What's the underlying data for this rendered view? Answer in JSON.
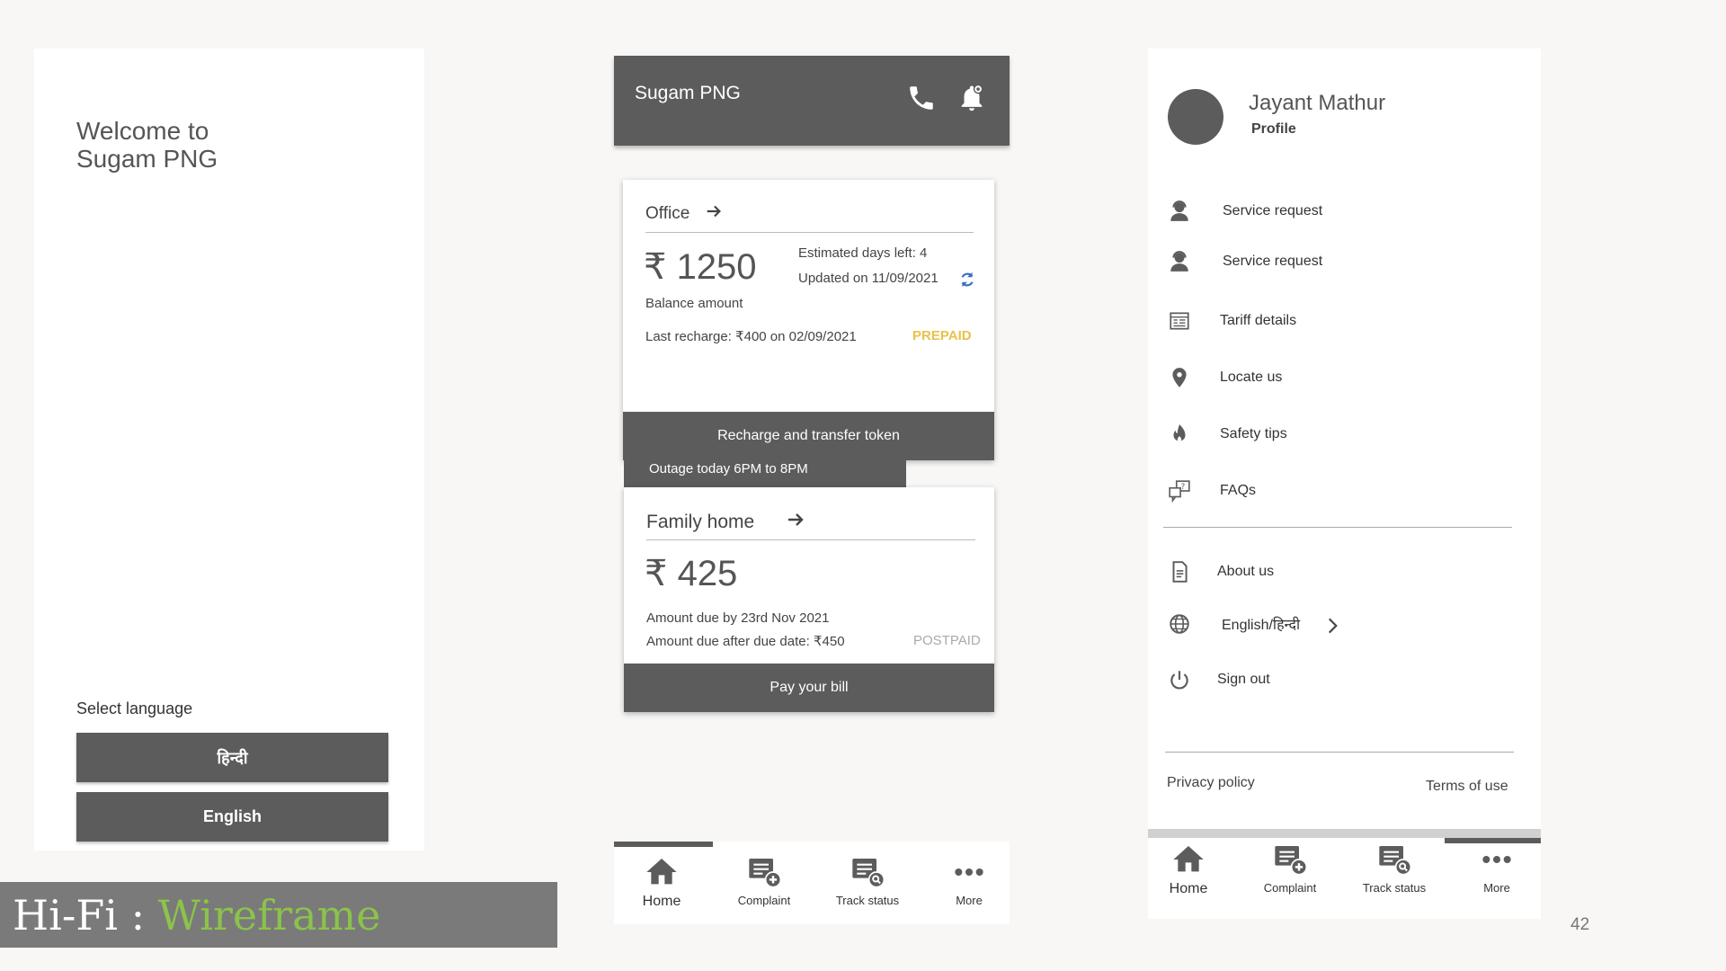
{
  "welcome_screen": {
    "welcome_line1": "Welcome to",
    "welcome_line2": "Sugam PNG",
    "select_language_label": "Select language",
    "hindi_button": "हिन्दी",
    "english_button": "English"
  },
  "banner": {
    "prefix": "Hi-Fi : ",
    "accent": "Wireframe",
    "accent_color": "#8bc34a"
  },
  "home_screen": {
    "app_title": "Sugam PNG",
    "call_icon": "phone-icon",
    "notification_icon": "bell-icon",
    "office_card": {
      "title": "Office",
      "amount": "₹ 1250",
      "amount_caption": "Balance amount",
      "estimated_days": "Estimated days left: 4",
      "updated_on": "Updated on 11/09/2021",
      "last_recharge": "Last recharge: ₹400 on 02/09/2021",
      "tag": "PREPAID",
      "tag_color": "#e8c24a",
      "button": "Recharge and transfer token"
    },
    "outage_notice": "Outage today 6PM to 8PM",
    "family_card": {
      "title": "Family home",
      "amount": "₹ 425",
      "due_by": "Amount due by 23rd Nov 2021",
      "due_after": "Amount due after due date: ₹450",
      "tag": "POSTPAID",
      "tag_color": "#aaaaaa",
      "button": "Pay your bill"
    },
    "bottom_nav": [
      {
        "label": "Home",
        "icon": "home-icon",
        "active": true
      },
      {
        "label": "Complaint",
        "icon": "complaint-icon"
      },
      {
        "label": "Track status",
        "icon": "track-status-icon"
      },
      {
        "label": "More",
        "icon": "more-icon"
      }
    ]
  },
  "menu_screen": {
    "profile_name": "Jayant Mathur",
    "profile_link": "Profile",
    "items": [
      {
        "label": "Service request",
        "icon": "user-headset-icon"
      },
      {
        "label": "Service request",
        "icon": "user-headset-icon"
      },
      {
        "label": "Tariff details",
        "icon": "tariff-icon"
      },
      {
        "label": "Locate us",
        "icon": "location-pin-icon"
      },
      {
        "label": "Safety tips",
        "icon": "flame-icon"
      },
      {
        "label": "FAQs",
        "icon": "faq-icon"
      },
      {
        "label": "About us",
        "icon": "document-icon"
      },
      {
        "label": "English/हिन्दी",
        "icon": "globe-icon"
      },
      {
        "label": "Sign out",
        "icon": "power-icon"
      }
    ],
    "privacy_policy": "Privacy policy",
    "terms_of_use": "Terms of use",
    "bottom_nav": [
      {
        "label": "Home",
        "icon": "home-icon",
        "active": true
      },
      {
        "label": "Complaint",
        "icon": "complaint-icon"
      },
      {
        "label": "Track status",
        "icon": "track-status-icon"
      },
      {
        "label": "More",
        "icon": "more-icon",
        "selected": true
      }
    ]
  },
  "page_number": "42"
}
